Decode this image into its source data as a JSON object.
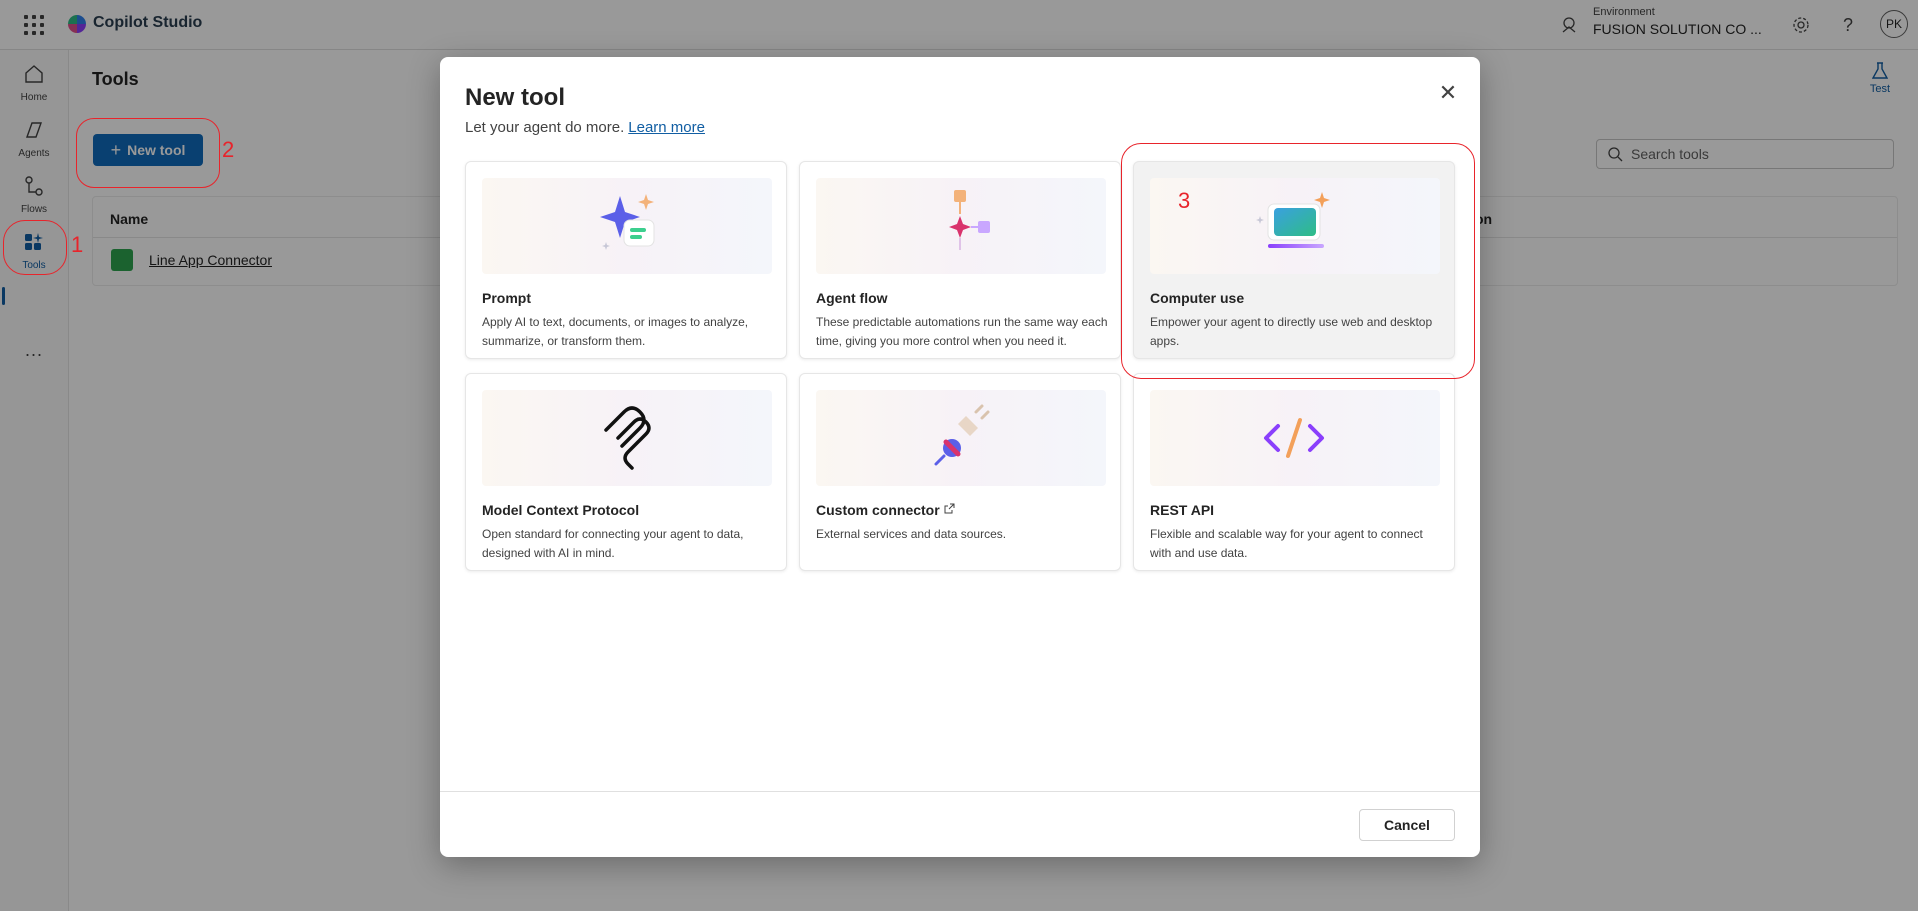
{
  "app": {
    "title": "Copilot Studio"
  },
  "topbar": {
    "environment_label": "Environment",
    "environment_value": "FUSION SOLUTION CO ...",
    "avatar_initials": "PK"
  },
  "rail": {
    "items": [
      {
        "label": "Home",
        "icon": "home-icon"
      },
      {
        "label": "Agents",
        "icon": "agents-icon"
      },
      {
        "label": "Flows",
        "icon": "flows-icon"
      },
      {
        "label": "Tools",
        "icon": "tools-icon",
        "active": true
      }
    ],
    "more_label": "..."
  },
  "page": {
    "title": "Tools",
    "test_label": "Test",
    "new_tool_label": "New tool",
    "search_placeholder": "Search tools",
    "table": {
      "col_name": "Name",
      "col_right_partial": "on",
      "rows": [
        {
          "name": "Line App Connector"
        }
      ]
    }
  },
  "dialog": {
    "title": "New tool",
    "subtitle": "Let your agent do more.",
    "learn_more": "Learn more",
    "cards": [
      {
        "title": "Prompt",
        "description": "Apply AI to text, documents, or images to analyze, summarize, or transform them."
      },
      {
        "title": "Agent flow",
        "description": "These predictable automations run the same way each time, giving you more control when you need it."
      },
      {
        "title": "Computer use",
        "description": "Empower your agent to directly use web and desktop apps."
      },
      {
        "title": "Model Context Protocol",
        "description": "Open standard for connecting your agent to data, designed with AI in mind."
      },
      {
        "title": "Custom connector",
        "description": "External services and data sources."
      },
      {
        "title": "REST API",
        "description": "Flexible and scalable way for your agent to connect with and use data."
      }
    ],
    "cancel_label": "Cancel"
  },
  "annotations": {
    "step1": "1",
    "step2": "2",
    "step3": "3"
  },
  "colors": {
    "accent": "#0f6cbd",
    "annotation": "#e8242b",
    "overlay": "rgba(0,0,0,0.4)"
  }
}
